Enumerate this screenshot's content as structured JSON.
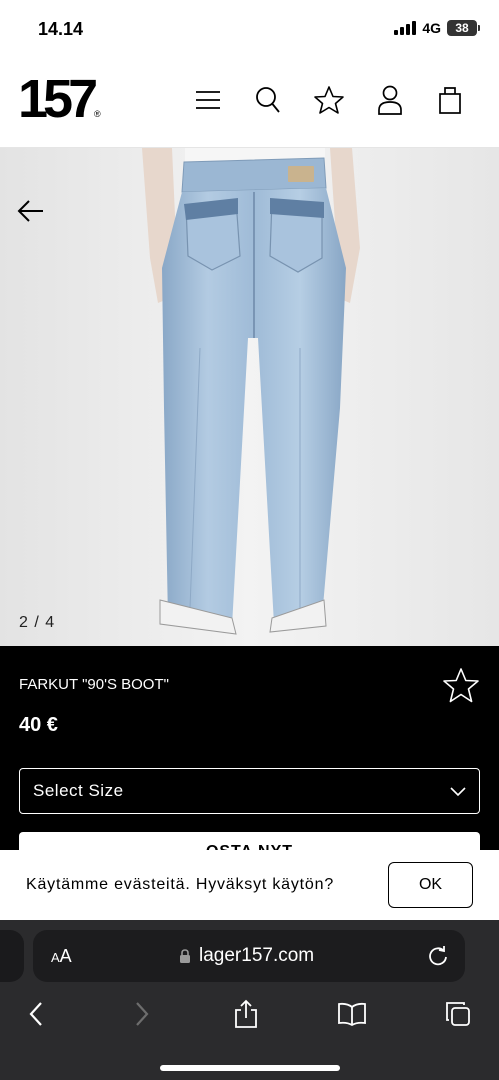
{
  "status_bar": {
    "time": "14.14",
    "network": "4G",
    "battery": "38"
  },
  "header": {
    "logo": "157",
    "logo_tag": "®",
    "icons": [
      "menu-icon",
      "search-icon",
      "star-icon",
      "user-icon",
      "bag-icon"
    ]
  },
  "gallery": {
    "counter": "2 / 4"
  },
  "product": {
    "title": "FARKUT \"90'S BOOT\"",
    "price": "40 €",
    "size_select": "Select Size",
    "buy_label": "OSTA NYT"
  },
  "cookie": {
    "text": "Käytämme evästeitä. Hyväksyt käytön?",
    "ok_label": "OK"
  },
  "browser": {
    "aa_label_small": "A",
    "aa_label_big": "A",
    "url": "lager157.com"
  },
  "colors": {
    "jeans": "#a9c4df",
    "background": "#efefef",
    "dark": "#000000"
  }
}
